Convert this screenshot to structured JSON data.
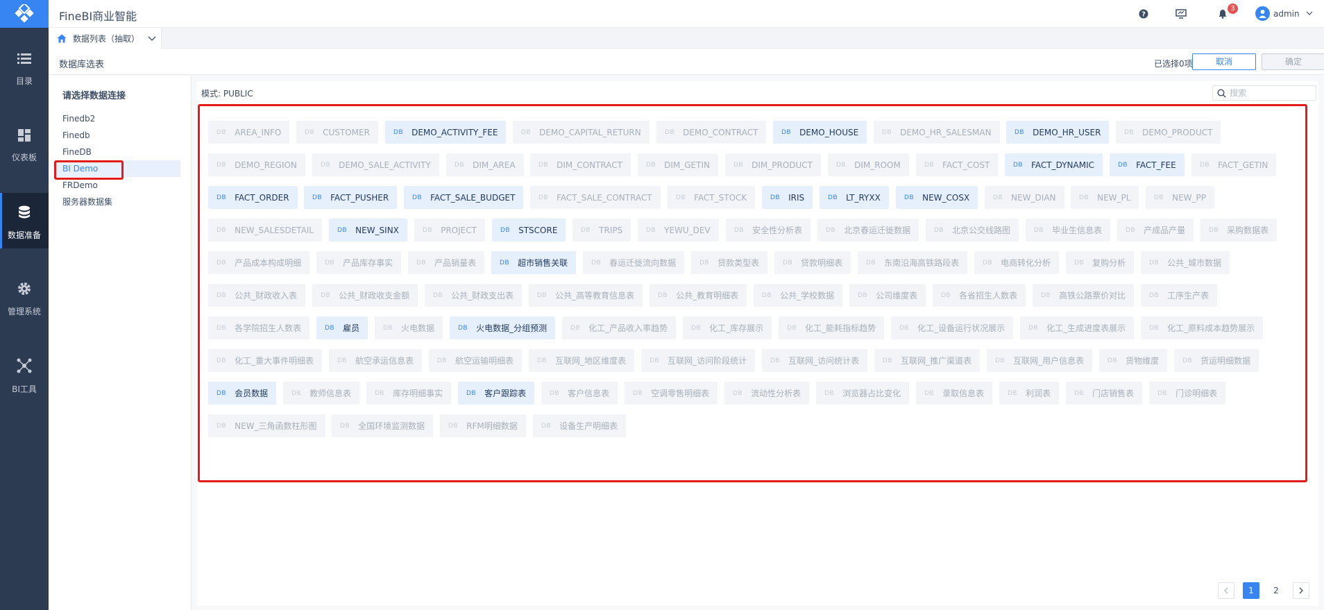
{
  "app": {
    "title": "FineBI商业智能"
  },
  "nav": [
    {
      "id": "catalog",
      "label": "目录"
    },
    {
      "id": "dashboard",
      "label": "仪表板"
    },
    {
      "id": "data-prep",
      "label": "数据准备"
    },
    {
      "id": "admin",
      "label": "管理系统"
    },
    {
      "id": "bi-tools",
      "label": "BI工具"
    }
  ],
  "topbar": {
    "notification_count": "3",
    "user": "admin"
  },
  "tab": {
    "label": "数据列表（抽取）"
  },
  "header": {
    "title": "数据库选表",
    "selected_count": "已选择0项",
    "cancel": "取消",
    "confirm": "确定"
  },
  "connections": {
    "heading": "请选择数据连接",
    "items": [
      "Finedb2",
      "Finedb",
      "FineDB",
      "BI Demo",
      "FRDemo",
      "服务器数据集"
    ],
    "selected_index": 3
  },
  "schema": {
    "label": "模式: PUBLIC"
  },
  "search": {
    "placeholder": "搜索"
  },
  "db_badge": "DB",
  "rows": [
    [
      {
        "name": "AREA_INFO",
        "on": false
      },
      {
        "name": "CUSTOMER",
        "on": false
      },
      {
        "name": "DEMO_ACTIVITY_FEE",
        "on": true
      },
      {
        "name": "DEMO_CAPITAL_RETURN",
        "on": false
      },
      {
        "name": "DEMO_CONTRACT",
        "on": false
      },
      {
        "name": "DEMO_HOUSE",
        "on": true
      },
      {
        "name": "DEMO_HR_SALESMAN",
        "on": false
      },
      {
        "name": "DEMO_HR_USER",
        "on": true
      },
      {
        "name": "DEMO_PRODUCT",
        "on": false
      }
    ],
    [
      {
        "name": "DEMO_REGION",
        "on": false
      },
      {
        "name": "DEMO_SALE_ACTIVITY",
        "on": false
      },
      {
        "name": "DIM_AREA",
        "on": false
      },
      {
        "name": "DIM_CONTRACT",
        "on": false
      },
      {
        "name": "DIM_GETIN",
        "on": false
      },
      {
        "name": "DIM_PRODUCT",
        "on": false
      },
      {
        "name": "DIM_ROOM",
        "on": false
      },
      {
        "name": "FACT_COST",
        "on": false
      },
      {
        "name": "FACT_DYNAMIC",
        "on": true
      },
      {
        "name": "FACT_FEE",
        "on": true
      },
      {
        "name": "FACT_GETIN",
        "on": false
      }
    ],
    [
      {
        "name": "FACT_ORDER",
        "on": true
      },
      {
        "name": "FACT_PUSHER",
        "on": true
      },
      {
        "name": "FACT_SALE_BUDGET",
        "on": true
      },
      {
        "name": "FACT_SALE_CONTRACT",
        "on": false
      },
      {
        "name": "FACT_STOCK",
        "on": false
      },
      {
        "name": "IRIS",
        "on": true
      },
      {
        "name": "LT_RYXX",
        "on": true
      },
      {
        "name": "NEW_COSX",
        "on": true
      },
      {
        "name": "NEW_DIAN",
        "on": false
      },
      {
        "name": "NEW_PL",
        "on": false
      },
      {
        "name": "NEW_PP",
        "on": false
      }
    ],
    [
      {
        "name": "NEW_SALESDETAIL",
        "on": false
      },
      {
        "name": "NEW_SINX",
        "on": true
      },
      {
        "name": "PROJECT",
        "on": false
      },
      {
        "name": "STSCORE",
        "on": true
      },
      {
        "name": "TRIPS",
        "on": false
      },
      {
        "name": "YEWU_DEV",
        "on": false
      },
      {
        "name": "安全性分析表",
        "on": false
      },
      {
        "name": "北京春运迁徙数据",
        "on": false
      },
      {
        "name": "北京公交线路图",
        "on": false
      },
      {
        "name": "毕业生信息表",
        "on": false
      },
      {
        "name": "产成品产量",
        "on": false
      },
      {
        "name": "采购数据表",
        "on": false
      }
    ],
    [
      {
        "name": "产品成本构成明细",
        "on": false
      },
      {
        "name": "产品库存事实",
        "on": false
      },
      {
        "name": "产品销量表",
        "on": false
      },
      {
        "name": "超市销售关联",
        "on": true
      },
      {
        "name": "春运迁徙流向数据",
        "on": false
      },
      {
        "name": "贷款类型表",
        "on": false
      },
      {
        "name": "贷款明细表",
        "on": false
      },
      {
        "name": "东南沿海高铁路段表",
        "on": false
      },
      {
        "name": "电商转化分析",
        "on": false
      },
      {
        "name": "复购分析",
        "on": false
      },
      {
        "name": "公共_城市数据",
        "on": false
      }
    ],
    [
      {
        "name": "公共_财政收入表",
        "on": false
      },
      {
        "name": "公共_财政收支金额",
        "on": false
      },
      {
        "name": "公共_财政支出表",
        "on": false
      },
      {
        "name": "公共_高等教育信息表",
        "on": false
      },
      {
        "name": "公共_教育明细表",
        "on": false
      },
      {
        "name": "公共_学校数据",
        "on": false
      },
      {
        "name": "公司维度表",
        "on": false
      },
      {
        "name": "各省招生人数表",
        "on": false
      },
      {
        "name": "高铁公路票价对比",
        "on": false
      },
      {
        "name": "工序生产表",
        "on": false
      }
    ],
    [
      {
        "name": "各学院招生人数表",
        "on": false
      },
      {
        "name": "雇员",
        "on": true
      },
      {
        "name": "火电数据",
        "on": false
      },
      {
        "name": "火电数据_分组预测",
        "on": true
      },
      {
        "name": "化工_产品收入率趋势",
        "on": false
      },
      {
        "name": "化工_库存展示",
        "on": false
      },
      {
        "name": "化工_能耗指标趋势",
        "on": false
      },
      {
        "name": "化工_设备运行状况展示",
        "on": false
      },
      {
        "name": "化工_生成进度表展示",
        "on": false
      },
      {
        "name": "化工_原料成本趋势展示",
        "on": false
      }
    ],
    [
      {
        "name": "化工_重大事件明细表",
        "on": false
      },
      {
        "name": "航空承运信息表",
        "on": false
      },
      {
        "name": "航空运输明细表",
        "on": false
      },
      {
        "name": "互联网_地区维度表",
        "on": false
      },
      {
        "name": "互联网_访问阶段统计",
        "on": false
      },
      {
        "name": "互联网_访问统计表",
        "on": false
      },
      {
        "name": "互联网_推广渠道表",
        "on": false
      },
      {
        "name": "互联网_用户信息表",
        "on": false
      },
      {
        "name": "货物维度",
        "on": false
      },
      {
        "name": "货运明细数据",
        "on": false
      }
    ],
    [
      {
        "name": "会员数据",
        "on": true
      },
      {
        "name": "教师信息表",
        "on": false
      },
      {
        "name": "库存明细事实",
        "on": false
      },
      {
        "name": "客户跟踪表",
        "on": true
      },
      {
        "name": "客户信息表",
        "on": false
      },
      {
        "name": "空调零售明细表",
        "on": false
      },
      {
        "name": "流动性分析表",
        "on": false
      },
      {
        "name": "浏览器占比变化",
        "on": false
      },
      {
        "name": "录取信息表",
        "on": false
      },
      {
        "name": "利润表",
        "on": false
      },
      {
        "name": "门店销售表",
        "on": false
      },
      {
        "name": "门诊明细表",
        "on": false
      }
    ],
    [
      {
        "name": "NEW_三角函数柱形图",
        "on": false
      },
      {
        "name": "全国环境监测数据",
        "on": false
      },
      {
        "name": "RFM明细数据",
        "on": false
      },
      {
        "name": "设备生产明细表",
        "on": false
      }
    ]
  ],
  "pagination": {
    "pages": [
      "1",
      "2"
    ],
    "current": "1"
  },
  "colors": {
    "accent": "#3685f2",
    "nav_bg": "#2c3a52",
    "highlight": "#e31b1b",
    "selected_chip": "#e6effc",
    "disabled_chip": "#f2f4f7"
  }
}
